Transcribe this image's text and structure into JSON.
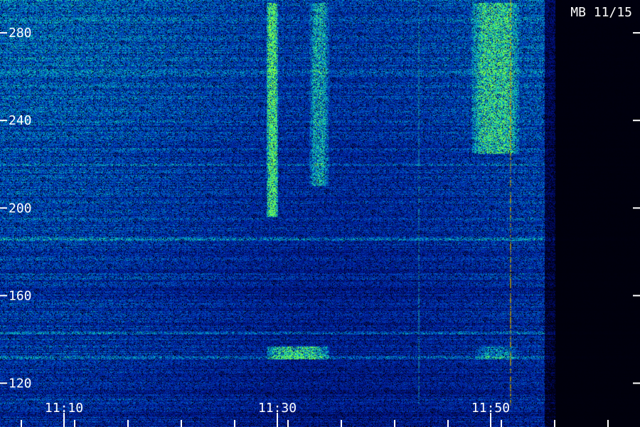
{
  "chart_data": {
    "type": "heatmap",
    "title": "MB 11/15",
    "xlabel": "",
    "ylabel": "",
    "x_tick_labels": [
      "11:10",
      "11:30",
      "11:50"
    ],
    "x_tick_minutes": [
      10,
      30,
      50
    ],
    "x_range_minutes": [
      4,
      64
    ],
    "x_minor_ticks_minutes": [
      6,
      11,
      16,
      21,
      26,
      31,
      36,
      41,
      46,
      51,
      56,
      61
    ],
    "y_tick_labels": [
      "120",
      "160",
      "200",
      "240",
      "280"
    ],
    "y_tick_values": [
      120,
      160,
      200,
      240,
      280
    ],
    "y_range": [
      100,
      295
    ],
    "data_end_minute": 55,
    "grid": false,
    "legend": "none",
    "colormap": [
      "#000020",
      "#001080",
      "#0040c0",
      "#00a0c0",
      "#20e0a0",
      "#80ff40"
    ],
    "bright_regions": [
      {
        "t_start": 29.0,
        "t_end": 30.0,
        "f_start": 196,
        "f_end": 294,
        "intensity": 0.9
      },
      {
        "t_start": 33.0,
        "t_end": 34.8,
        "f_start": 210,
        "f_end": 294,
        "intensity": 0.55
      },
      {
        "t_start": 48.2,
        "t_end": 52.6,
        "f_start": 225,
        "f_end": 294,
        "intensity": 0.7
      },
      {
        "t_start": 29.0,
        "t_end": 34.8,
        "f_start": 131,
        "f_end": 137,
        "intensity": 0.75
      },
      {
        "t_start": 48.5,
        "t_end": 52.4,
        "f_start": 131,
        "f_end": 137,
        "intensity": 0.45
      }
    ],
    "horizontal_lines": [
      {
        "freq": 132,
        "intensity": 0.6
      },
      {
        "freq": 143,
        "intensity": 0.5
      },
      {
        "freq": 186,
        "intensity": 0.55
      },
      {
        "freq": 220,
        "intensity": 0.3
      },
      {
        "freq": 262,
        "intensity": 0.35
      }
    ],
    "vertical_lines": [
      {
        "t": 51.8,
        "intensity": 0.7,
        "color": "#c0a000"
      },
      {
        "t": 43.2,
        "intensity": 0.35,
        "color": "#30e0a0"
      }
    ]
  }
}
